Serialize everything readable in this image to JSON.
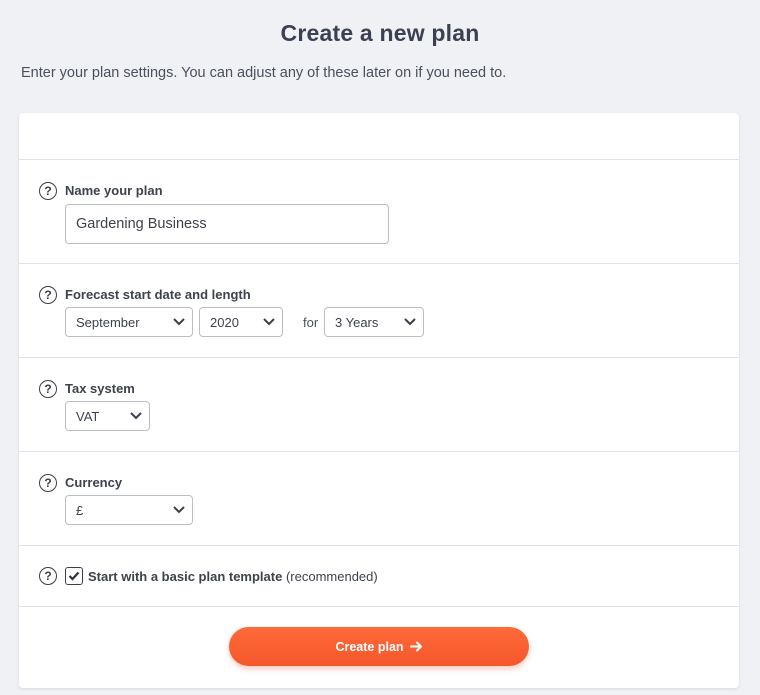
{
  "header": {
    "title": "Create a new plan",
    "subtitle": "Enter your plan settings. You can adjust any of these later on if you need to."
  },
  "form": {
    "name": {
      "label": "Name your plan",
      "value": "Gardening Business",
      "help_icon": "question-circle-icon"
    },
    "forecast": {
      "label": "Forecast start date and length",
      "month": "September",
      "year": "2020",
      "for_label": "for",
      "length": "3 Years",
      "help_icon": "question-circle-icon"
    },
    "tax": {
      "label": "Tax system",
      "value": "VAT",
      "help_icon": "question-circle-icon"
    },
    "currency": {
      "label": "Currency",
      "value": "£",
      "help_icon": "question-circle-icon"
    },
    "template": {
      "label_bold": "Start with a basic plan template",
      "label_rest": "(recommended)",
      "checked": true,
      "help_icon": "question-circle-icon"
    }
  },
  "actions": {
    "create_label": "Create plan",
    "create_icon": "arrow-right-icon",
    "create_color": "#f4572a"
  }
}
